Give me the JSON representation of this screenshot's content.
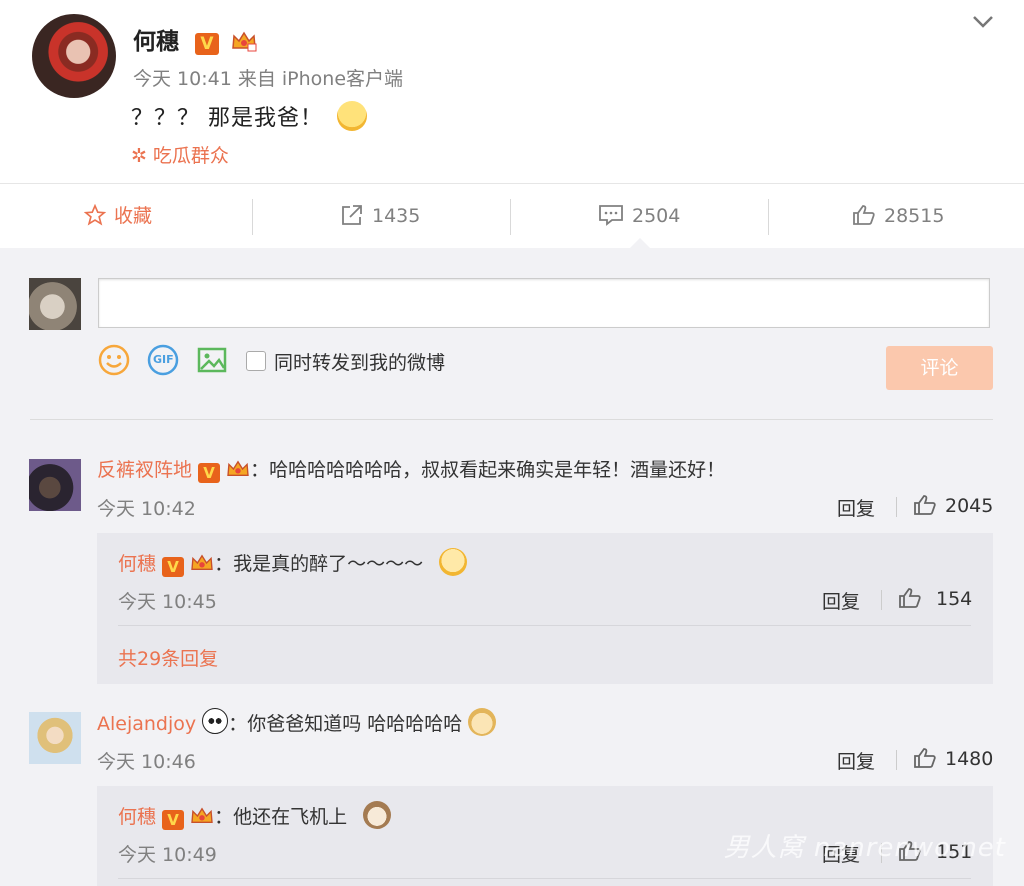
{
  "post": {
    "author": "何穗",
    "v_badge": "V",
    "meta": "今天 10:41 来自 iPhone客户端",
    "text": "？？？ 那是我爸！",
    "topic": "吃瓜群众"
  },
  "actions": {
    "favorite": "收藏",
    "repost_count": "1435",
    "comment_count": "2504",
    "like_count": "28515"
  },
  "composer": {
    "repost_label": "同时转发到我的微博",
    "submit_label": "评论",
    "gif_label": "GIF"
  },
  "comments": [
    {
      "user": "反裤衩阵地",
      "text": "：哈哈哈哈哈哈哈，叔叔看起来确实是年轻！酒量还好！",
      "time": "今天 10:42",
      "reply_label": "回复",
      "likes": "2045",
      "reply": {
        "user": "何穗",
        "text": "：我是真的醉了～～～～",
        "time": "今天 10:45",
        "reply_label": "回复",
        "likes": "154"
      },
      "more_replies": "共29条回复"
    },
    {
      "user": "Alejandjoy",
      "text": "：你爸爸知道吗 哈哈哈哈哈",
      "time": "今天 10:46",
      "reply_label": "回复",
      "likes": "1480",
      "reply": {
        "user": "何穗",
        "text": "：他还在飞机上",
        "time": "今天 10:49",
        "reply_label": "回复",
        "likes": "151"
      }
    }
  ],
  "watermark": "男人窝 nanrenwo.net",
  "colors": {
    "accent": "#eb7350",
    "submit_bg": "#fbc8ad",
    "comment_bg": "#f2f2f5",
    "reply_bg": "#e8e8ed"
  }
}
